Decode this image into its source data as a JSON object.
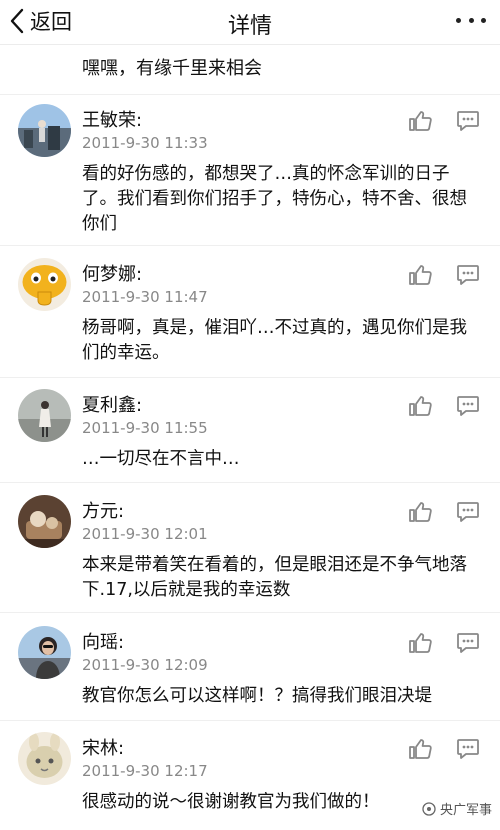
{
  "nav": {
    "back_label": "返回",
    "title": "详情"
  },
  "top_text": "嘿嘿，有缘千里来相会",
  "comments": [
    {
      "name": "王敏荣:",
      "time": "2011-9-30 11:33",
      "text": "看的好伤感的，都想哭了…真的怀念军训的日子了。我们看到你们招手了，特伤心，特不舍、很想你们"
    },
    {
      "name": "何梦娜:",
      "time": "2011-9-30 11:47",
      "text": "杨哥啊，真是，催泪吖…不过真的，遇见你们是我们的幸运。"
    },
    {
      "name": "夏利鑫:",
      "time": "2011-9-30 11:55",
      "text": "…一切尽在不言中…"
    },
    {
      "name": "方元:",
      "time": "2011-9-30 12:01",
      "text": "本来是带着笑在看着的，但是眼泪还是不争气地落下.17,以后就是我的幸运数"
    },
    {
      "name": "向瑶:",
      "time": "2011-9-30 12:09",
      "text": "教官你怎么可以这样啊！？搞得我们眼泪决堤"
    },
    {
      "name": "宋林:",
      "time": "2011-9-30 12:17",
      "text": "很感动的说～很谢谢教官为我们做的！"
    }
  ],
  "watermark": "央广军事",
  "icons": {
    "back": "chevron-left-icon",
    "more": "more-dots-icon",
    "like": "thumbs-up-icon",
    "reply": "comment-bubble-icon"
  }
}
